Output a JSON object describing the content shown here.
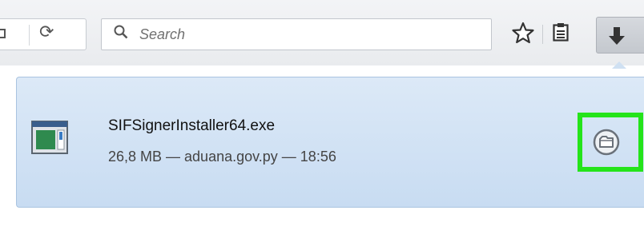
{
  "toolbar": {
    "search": {
      "placeholder": "Search"
    },
    "icons": [
      "stop-icon",
      "reload-icon",
      "search-icon",
      "bookmark-star-icon",
      "reading-list-icon",
      "download-arrow-icon"
    ]
  },
  "downloads": {
    "items": [
      {
        "file_name": "SIFSignerInstaller64.exe",
        "meta": "26,8 MB — aduana.gov.py — 18:56",
        "icon": "executable-file-icon",
        "action_icon": "open-containing-folder-icon"
      }
    ]
  },
  "colors": {
    "highlight": "#24e41a",
    "item_background": "#d2e3f5"
  }
}
